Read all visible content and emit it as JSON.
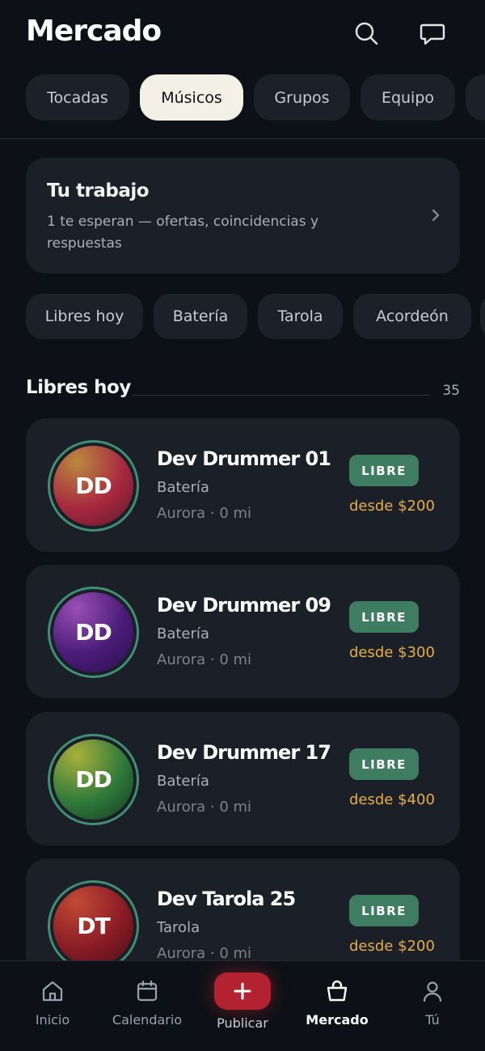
{
  "header": {
    "title": "Mercado",
    "search_icon": "search-icon",
    "chat_icon": "chat-bubble-icon"
  },
  "tabs": [
    {
      "label": "Tocadas",
      "active": false
    },
    {
      "label": "Músicos",
      "active": true
    },
    {
      "label": "Grupos",
      "active": false
    },
    {
      "label": "Equipo",
      "active": false
    },
    {
      "label": "",
      "active": false
    }
  ],
  "work": {
    "title": "Tu trabajo",
    "subtitle": "1 te esperan — ofertas, coincidencias y respuestas"
  },
  "chips": [
    {
      "label": "Libres hoy"
    },
    {
      "label": "Batería"
    },
    {
      "label": "Tarola"
    },
    {
      "label": "Acordeón"
    },
    {
      "label": ""
    }
  ],
  "section": {
    "title": "Libres hoy",
    "count": "35"
  },
  "musicians": [
    {
      "initials": "DD",
      "name": "Dev Drummer 01",
      "instrument": "Batería",
      "location": "Aurora · 0 mi",
      "badge": "LIBRE",
      "price": "desde $200",
      "avatar_colors": [
        "#b98a3e",
        "#a8283f",
        "#5a1a2a"
      ]
    },
    {
      "initials": "DD",
      "name": "Dev Drummer 09",
      "instrument": "Batería",
      "location": "Aurora · 0 mi",
      "badge": "LIBRE",
      "price": "desde $300",
      "avatar_colors": [
        "#9a4fb3",
        "#4a1c78",
        "#2a0f4a"
      ]
    },
    {
      "initials": "DD",
      "name": "Dev Drummer 17",
      "instrument": "Batería",
      "location": "Aurora · 0 mi",
      "badge": "LIBRE",
      "price": "desde $400",
      "avatar_colors": [
        "#a8b03a",
        "#2f7a3a",
        "#123a22"
      ]
    },
    {
      "initials": "DT",
      "name": "Dev Tarola 25",
      "instrument": "Tarola",
      "location": "Aurora · 0 mi",
      "badge": "LIBRE",
      "price": "desde $200",
      "avatar_colors": [
        "#c24a34",
        "#8a1c26",
        "#4a0f16"
      ]
    }
  ],
  "nav": [
    {
      "label": "Inicio",
      "icon": "home-icon",
      "active": false
    },
    {
      "label": "Calendario",
      "icon": "calendar-icon",
      "active": false
    },
    {
      "label": "Publicar",
      "icon": "plus-icon",
      "active": false
    },
    {
      "label": "Mercado",
      "icon": "shopping-bag-icon",
      "active": true
    },
    {
      "label": "Tú",
      "icon": "user-icon",
      "active": false
    }
  ],
  "colors": {
    "background": "#0d1117",
    "card": "#1a1f28",
    "accent_green": "#3f7d62",
    "price": "#e7ad45",
    "publish": "#b3232f"
  }
}
